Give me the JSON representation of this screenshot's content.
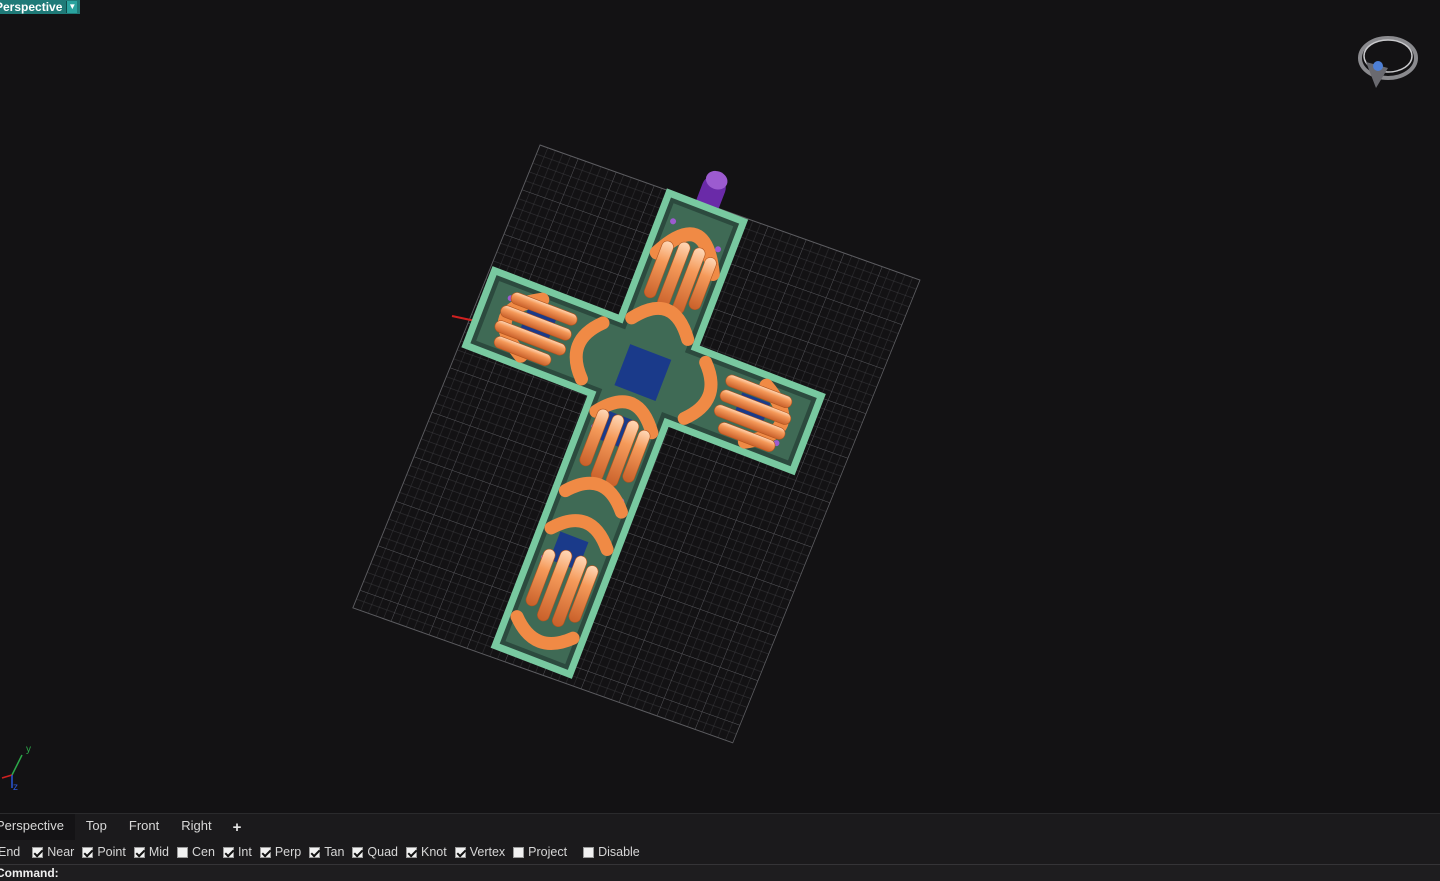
{
  "viewport": {
    "title": "Perspective",
    "dropdown_icon": "chevron-down-icon",
    "background": "#131214",
    "grid_color": "#4a4a4e",
    "navigation_widget_icon": "ring-view-cube-icon",
    "axis_labels": {
      "x": "x",
      "y": "y",
      "z": "z"
    }
  },
  "model": {
    "name": "cross-pendant",
    "frame_color": "#6fbf95",
    "petal_color": "#f08a45",
    "stone_color": "#1a3a8a",
    "accent_color": "#9c5bd0",
    "bail_color": "#6a2aa8"
  },
  "tabs": [
    {
      "label": "Perspective",
      "active": true
    },
    {
      "label": "Top",
      "active": false
    },
    {
      "label": "Front",
      "active": false
    },
    {
      "label": "Right",
      "active": false
    }
  ],
  "add_tab_label": "+",
  "osnaps": [
    {
      "label": "End",
      "checked": false,
      "hide_box": true
    },
    {
      "label": "Near",
      "checked": true
    },
    {
      "label": "Point",
      "checked": true
    },
    {
      "label": "Mid",
      "checked": true
    },
    {
      "label": "Cen",
      "checked": false
    },
    {
      "label": "Int",
      "checked": true
    },
    {
      "label": "Perp",
      "checked": true
    },
    {
      "label": "Tan",
      "checked": true
    },
    {
      "label": "Quad",
      "checked": true
    },
    {
      "label": "Knot",
      "checked": true
    },
    {
      "label": "Vertex",
      "checked": true
    },
    {
      "label": "Project",
      "checked": false
    },
    {
      "label": "Disable",
      "checked": false
    }
  ],
  "command": {
    "label": "Command:",
    "value": ""
  }
}
